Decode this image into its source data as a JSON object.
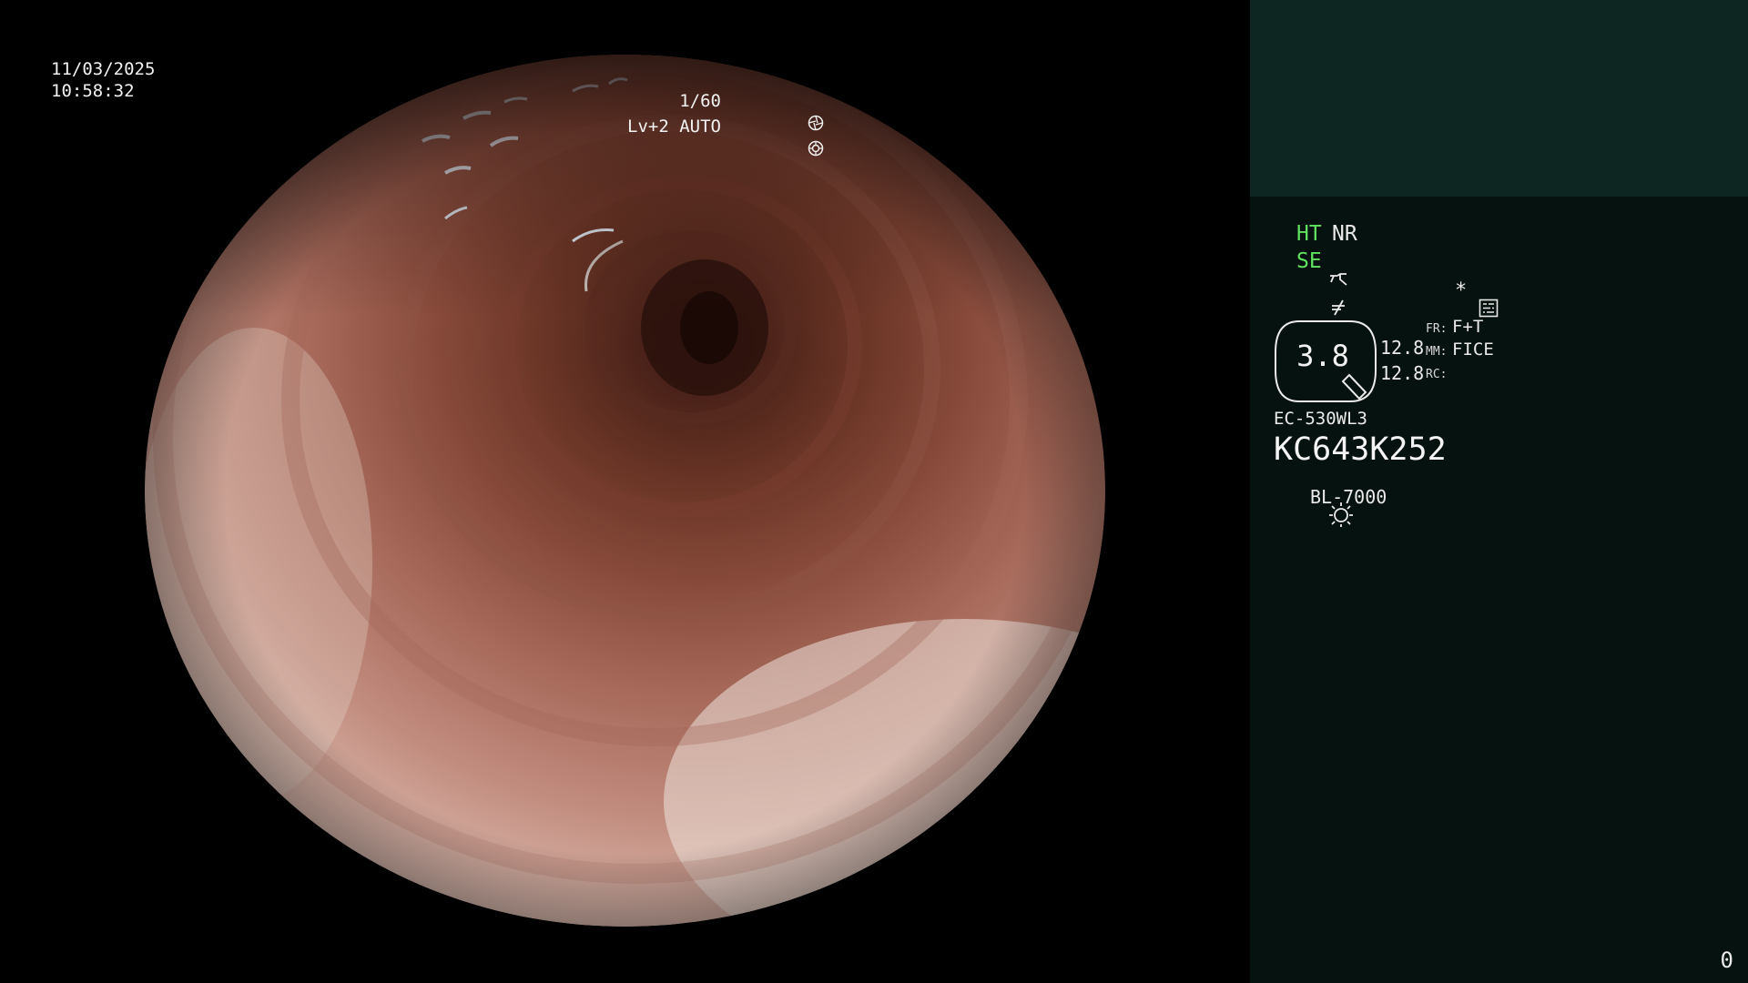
{
  "osd": {
    "date": "11/03/2025",
    "time": "10:58:32",
    "shutter": "1/60",
    "iris": "Lv+2 AUTO",
    "shutter_icon": "shutter-icon",
    "iris_icon": "iris-icon"
  },
  "panel": {
    "ht": "HT",
    "nr": "NR",
    "se": "SE",
    "se_icon": "structure-enhance-icon",
    "filter_icon": "filter-icon",
    "settings_icon": "settings-icon",
    "asterisk": "*",
    "zoom_value": "3.8",
    "zoom_line_1": "12.8",
    "zoom_line_2": "12.8",
    "fr_key": "FR:",
    "fr_val": "F+T",
    "mm_key": "MM:",
    "mm_val": "FICE",
    "rc_key": "RC:",
    "scope_model": "EC-530WL3",
    "scope_serial": "KC643K252",
    "light_icon": "light-source-icon",
    "light_label": "BL-7000",
    "counter": "0"
  },
  "colors": {
    "background": "#000000",
    "panel": "#06120f",
    "panel_top": "#0e2622",
    "accent_green": "#5fe25f",
    "text": "#eaeaea"
  }
}
